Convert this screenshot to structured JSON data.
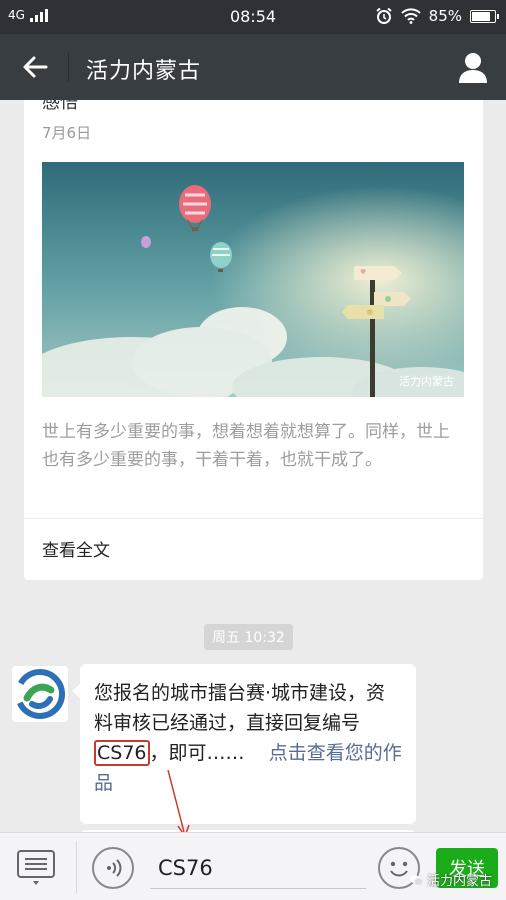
{
  "status_bar": {
    "network": "4G",
    "time": "08:54",
    "battery_text": "85%",
    "battery_level": 0.85
  },
  "nav": {
    "title": "活力内蒙古"
  },
  "article": {
    "title_fragment": "感悟",
    "date": "7月6日",
    "image_watermark": "活力内蒙古",
    "description": "世上有多少重要的事，想着想着就想算了。同样，世上也有多少重要的事，干着干着，也就干成了。",
    "read_more": "查看全文"
  },
  "timestamp": "周五 10:32",
  "message": {
    "text_before": "您报名的城市擂台赛·城市建设，资料审核已经通过，直接回复编号",
    "code": "CS76",
    "text_after": "，即可……",
    "link": "点击查看您的作品"
  },
  "input_bar": {
    "input_value": "CS76",
    "send_label": "发送"
  },
  "watermark": "活力内蒙古",
  "colors": {
    "nav": "#383d42",
    "status": "#2e3236",
    "send": "#1aad19",
    "link": "#576b95",
    "highlight": "#c83a30"
  }
}
